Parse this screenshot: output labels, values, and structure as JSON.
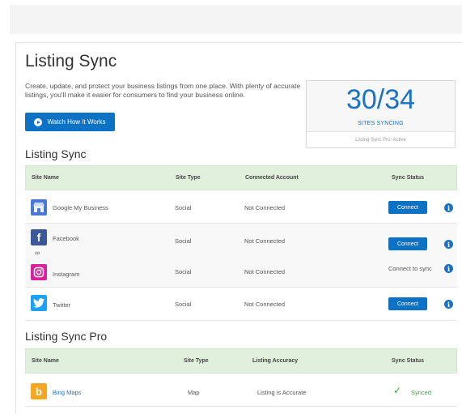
{
  "header": {
    "title": "Listing Sync",
    "description": "Create, update, and protect your business listings from one place. With plenty of accurate listings, you'll make it easier for consumers to find your business online.",
    "watch_label": "Watch How It Works"
  },
  "stats": {
    "count": "30/34",
    "label": "SITES SYNCING",
    "footer": "Listing Sync Pro: Active"
  },
  "listing_sync": {
    "title": "Listing Sync",
    "columns": [
      "Site Name",
      "Site Type",
      "Connected Account",
      "Sync Status"
    ],
    "rows": [
      {
        "name": "Google My Business",
        "type": "Social",
        "account": "Not Connected",
        "status": "Connect",
        "icon": "google-my-business-icon"
      },
      {
        "name": "Facebook",
        "type": "Social",
        "account": "Not Connected",
        "status": "Connect",
        "icon": "facebook-icon"
      },
      {
        "name": "Instagram",
        "type": "Social",
        "account": "Not Connected",
        "status": "Connect to sync",
        "icon": "instagram-icon"
      },
      {
        "name": "Twitter",
        "type": "Social",
        "account": "Not Connected",
        "status": "Connect",
        "icon": "twitter-icon"
      }
    ]
  },
  "listing_sync_pro": {
    "title": "Listing Sync Pro",
    "columns": [
      "Site Name",
      "Site Type",
      "Listing Accuracy",
      "Sync Status"
    ],
    "rows": [
      {
        "name": "Bing Maps",
        "type": "Map",
        "accuracy": "Listing is Accurate",
        "status": "Synced",
        "icon": "bing-icon"
      }
    ]
  },
  "colors": {
    "accent": "#0b72c6",
    "header_green": "#e0f0dc",
    "synced": "#3aa83a",
    "facebook": "#3b5998",
    "twitter": "#1da1f2",
    "instagram": "#d6249f",
    "bing": "#f5a623",
    "google": "#4a78d6"
  }
}
